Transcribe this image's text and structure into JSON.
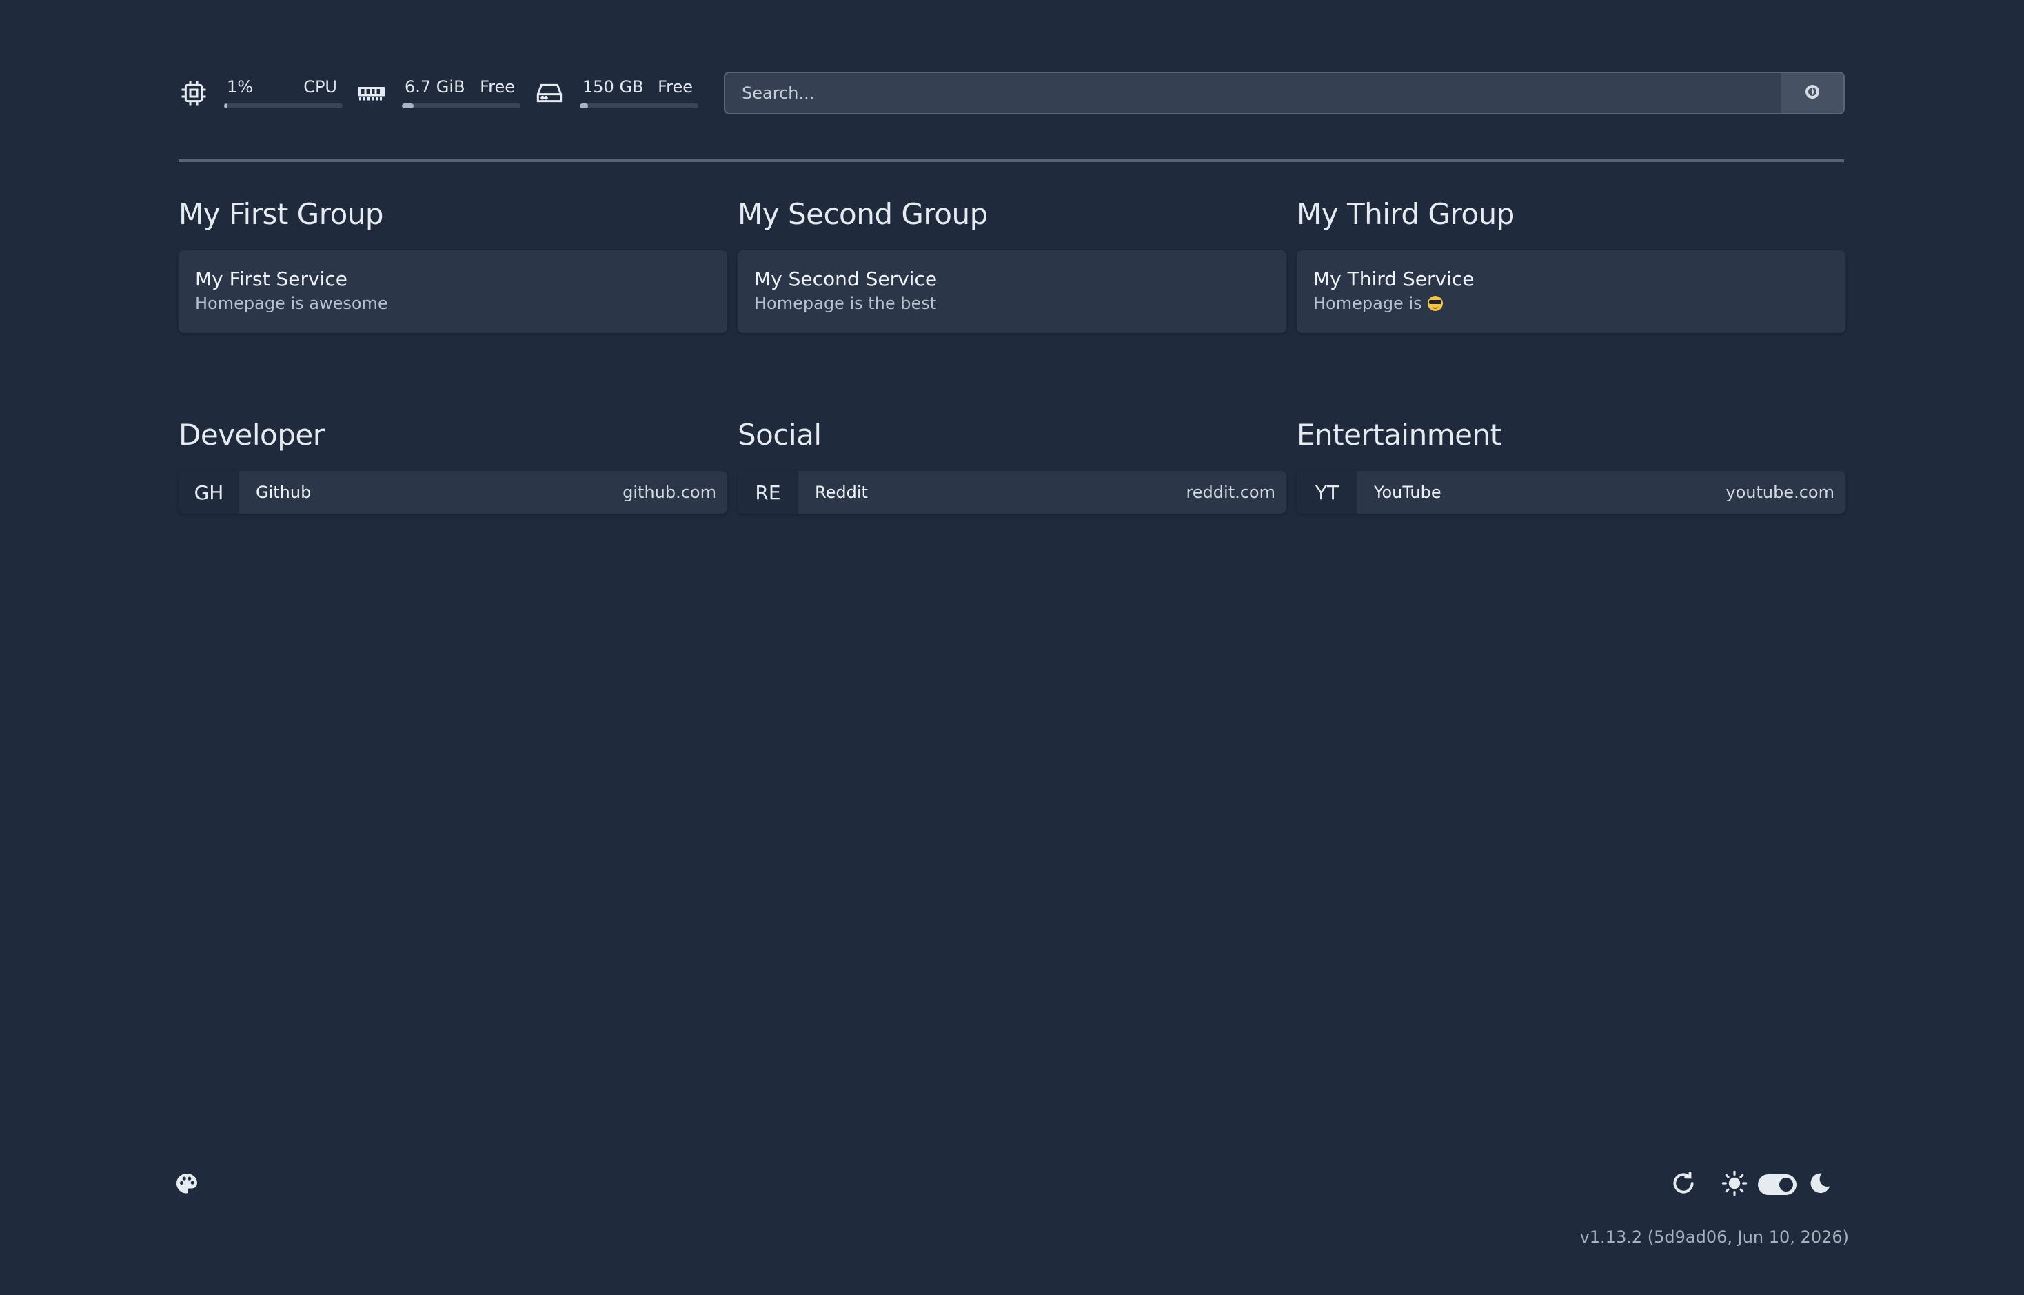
{
  "widgets": {
    "cpu": {
      "value": "1%",
      "label": "CPU",
      "icon": "cpu-chip-icon",
      "usage": 0.01
    },
    "memory": {
      "value": "6.7 GiB",
      "label": "Free",
      "icon": "memory-icon",
      "usage": 0.1
    },
    "disk": {
      "value": "150 GB",
      "label": "Free",
      "icon": "disk-drive-icon",
      "usage": 0.07
    }
  },
  "search": {
    "placeholder": "Search...",
    "provider_icon": "search-provider-icon"
  },
  "services": [
    {
      "group": "My First Group",
      "name": "My First Service",
      "description": "Homepage is awesome",
      "emoji": ""
    },
    {
      "group": "My Second Group",
      "name": "My Second Service",
      "description": "Homepage is the best",
      "emoji": ""
    },
    {
      "group": "My Third Group",
      "name": "My Third Service",
      "description": "Homepage is",
      "emoji": "sunglasses-emoji"
    }
  ],
  "bookmarks": [
    {
      "group": "Developer",
      "abbr": "GH",
      "name": "Github",
      "href": "github.com"
    },
    {
      "group": "Social",
      "abbr": "RE",
      "name": "Reddit",
      "href": "reddit.com"
    },
    {
      "group": "Entertainment",
      "abbr": "YT",
      "name": "YouTube",
      "href": "youtube.com"
    }
  ],
  "footer": {
    "version": "v1.13.2 (5d9ad06, Jun 10, 2026)",
    "theme": "dark"
  },
  "colors": {
    "background": "#1f2a3c",
    "card": "#2b3648",
    "text": "#e6ebf2",
    "muted": "#b8c1ce"
  }
}
